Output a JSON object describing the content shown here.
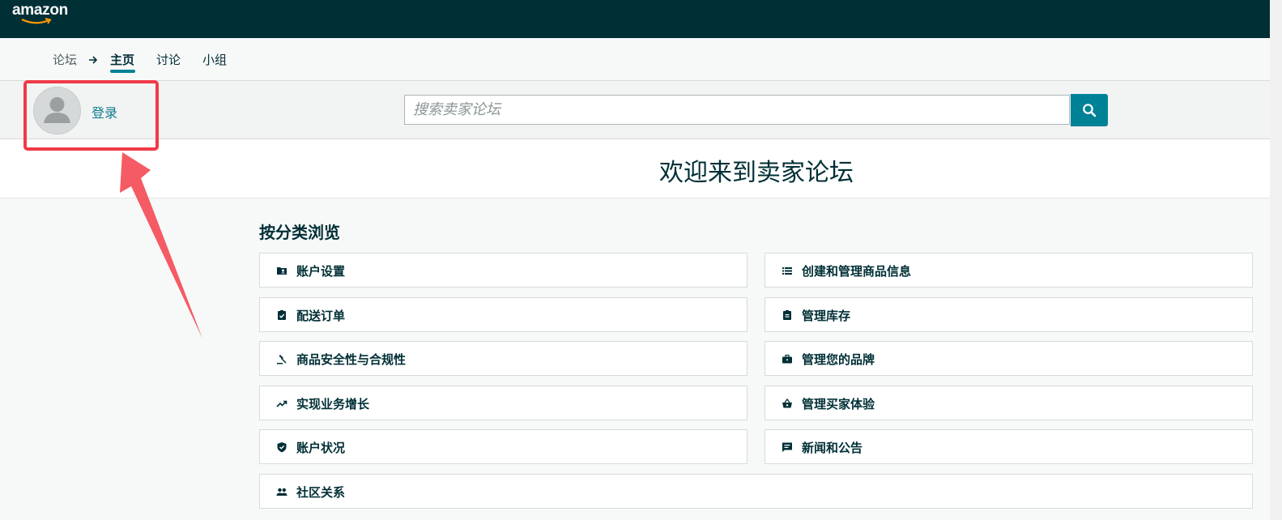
{
  "header": {
    "logo_text": "amazon",
    "bg_color": "#002f36"
  },
  "nav": {
    "breadcrumb_root": "论坛",
    "arrow_icon": "arrow-right-icon",
    "tabs": [
      {
        "label": "主页",
        "active": true
      },
      {
        "label": "讨论",
        "active": false
      },
      {
        "label": "小组",
        "active": false
      }
    ]
  },
  "user": {
    "login_label": "登录",
    "avatar_icon": "person-icon"
  },
  "search": {
    "placeholder": "搜索卖家论坛",
    "button_icon": "search-icon",
    "accent_color": "#008296"
  },
  "welcome": {
    "title": "欢迎来到卖家论坛"
  },
  "categories": {
    "heading": "按分类浏览",
    "items": [
      {
        "label": "账户设置",
        "icon": "account-card-icon"
      },
      {
        "label": "创建和管理商品信息",
        "icon": "list-icon"
      },
      {
        "label": "配送订单",
        "icon": "clipboard-check-icon"
      },
      {
        "label": "管理库存",
        "icon": "clipboard-icon"
      },
      {
        "label": "商品安全性与合规性",
        "icon": "gavel-icon"
      },
      {
        "label": "管理您的品牌",
        "icon": "briefcase-icon"
      },
      {
        "label": "实现业务增长",
        "icon": "trending-up-icon"
      },
      {
        "label": "管理买家体验",
        "icon": "basket-icon"
      },
      {
        "label": "账户状况",
        "icon": "shield-check-icon"
      },
      {
        "label": "新闻和公告",
        "icon": "announcement-icon"
      },
      {
        "label": "社区关系",
        "icon": "people-icon"
      }
    ]
  },
  "annotation": {
    "color": "#f03a47"
  }
}
